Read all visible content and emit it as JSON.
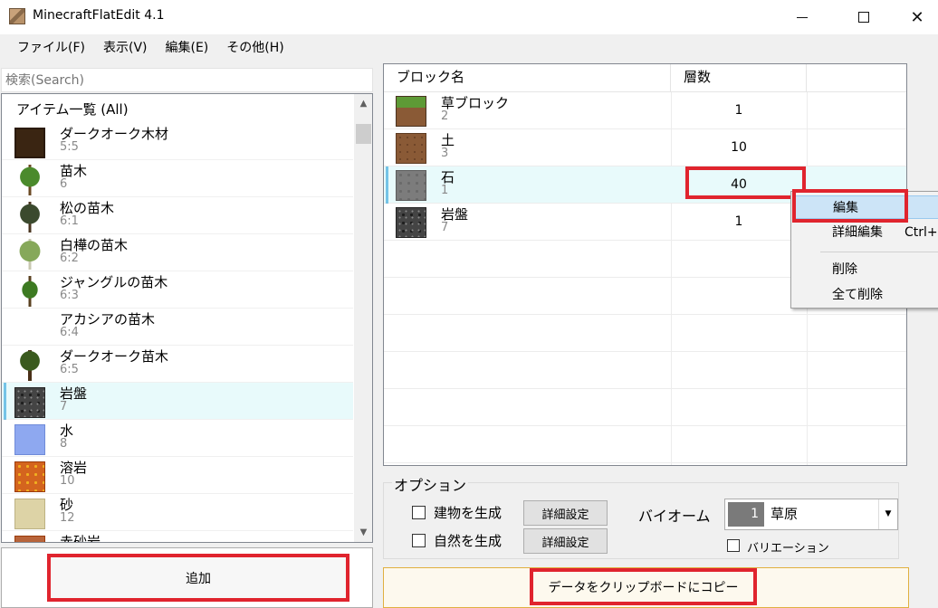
{
  "window": {
    "title": "MinecraftFlatEdit 4.1"
  },
  "menu": {
    "file": "ファイル(F)",
    "view": "表示(V)",
    "edit": "編集(E)",
    "other": "その他(H)"
  },
  "search": {
    "placeholder": "検索(Search)"
  },
  "item_list": {
    "header": "アイテム一覧 (All)",
    "items": [
      {
        "name": "ダークオーク木材",
        "id": "5:5",
        "icon": "dark-oak-planks-icon"
      },
      {
        "name": "苗木",
        "id": "6",
        "icon": "oak-sapling-icon"
      },
      {
        "name": "松の苗木",
        "id": "6:1",
        "icon": "spruce-sapling-icon"
      },
      {
        "name": "白樺の苗木",
        "id": "6:2",
        "icon": "birch-sapling-icon"
      },
      {
        "name": "ジャングルの苗木",
        "id": "6:3",
        "icon": "jungle-sapling-icon"
      },
      {
        "name": "アカシアの苗木",
        "id": "6:4",
        "icon": "acacia-sapling-icon"
      },
      {
        "name": "ダークオーク苗木",
        "id": "6:5",
        "icon": "dark-oak-sapling-icon"
      },
      {
        "name": "岩盤",
        "id": "7",
        "icon": "bedrock-icon"
      },
      {
        "name": "水",
        "id": "8",
        "icon": "water-icon"
      },
      {
        "name": "溶岩",
        "id": "10",
        "icon": "lava-icon"
      },
      {
        "name": "砂",
        "id": "12",
        "icon": "sand-icon"
      },
      {
        "name": "赤砂岩",
        "id": "",
        "icon": "red-sand-icon"
      }
    ]
  },
  "add_button": "追加",
  "block_grid": {
    "col_name": "ブロック名",
    "col_layers": "層数",
    "rows": [
      {
        "name": "草ブロック",
        "id": "2",
        "layers": "1",
        "icon": "grass-block-icon"
      },
      {
        "name": "土",
        "id": "3",
        "layers": "10",
        "icon": "dirt-icon"
      },
      {
        "name": "石",
        "id": "1",
        "layers": "40",
        "icon": "stone-icon"
      },
      {
        "name": "岩盤",
        "id": "7",
        "layers": "1",
        "icon": "bedrock-icon"
      }
    ]
  },
  "context_menu": {
    "edit": "編集",
    "detail_edit": "詳細編集",
    "detail_shortcut": "Ctrl+S",
    "delete": "削除",
    "delete_all": "全て削除"
  },
  "options": {
    "title": "オプション",
    "structures_label": "建物を生成",
    "features_label": "自然を生成",
    "detail_button": "詳細設定",
    "biome_label": "バイオーム",
    "biome_id": "1",
    "biome_name": "草原",
    "variation_label": "バリエーション"
  },
  "copy_button": "データをクリップボードにコピー",
  "colors": {
    "highlight_red": "#e0242e",
    "selection": "#e8fafb",
    "menu_hover": "#cce4f7"
  }
}
